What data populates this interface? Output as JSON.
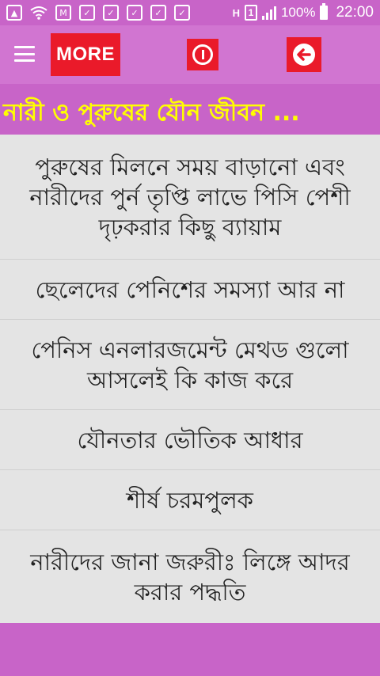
{
  "status_bar": {
    "carrier_mark": "H",
    "sim_slot": "1",
    "battery": "100%",
    "time": "22:00",
    "icons": [
      "image-icon",
      "wifi-icon",
      "gmail-icon",
      "briefcase-icon",
      "briefcase-icon",
      "briefcase-icon",
      "briefcase-icon",
      "briefcase-icon"
    ]
  },
  "app_bar": {
    "more_label": "MORE",
    "colors": {
      "app_bar_bg": "#d175d1",
      "button_bg": "#ea1a2a"
    }
  },
  "title": "নারী ও পুরুষের যৌন জীবন ...",
  "colors": {
    "title_text": "#ffff00",
    "primary": "#c864c8",
    "list_bg": "#e4e4e4"
  },
  "list": {
    "items": [
      {
        "label": "পুরুষের মিলনে সময় বাড়ানো এবং নারীদের পুর্ন তৃপ্তি লাভে পিসি পেশী দৃঢ়করার কিছু ব্যায়াম"
      },
      {
        "label": "ছেলেদের পেনিশের সমস্যা আর না"
      },
      {
        "label": "পেনিস এনলারজমেন্ট মেথড গুলো আসলেই কি কাজ করে"
      },
      {
        "label": "যৌনতার ভৌতিক আধার"
      },
      {
        "label": "শীর্ষ চরমপুলক"
      },
      {
        "label": "নারীদের জানা জরুরীঃ লিঙ্গে আদর করার পদ্ধতি"
      }
    ]
  }
}
